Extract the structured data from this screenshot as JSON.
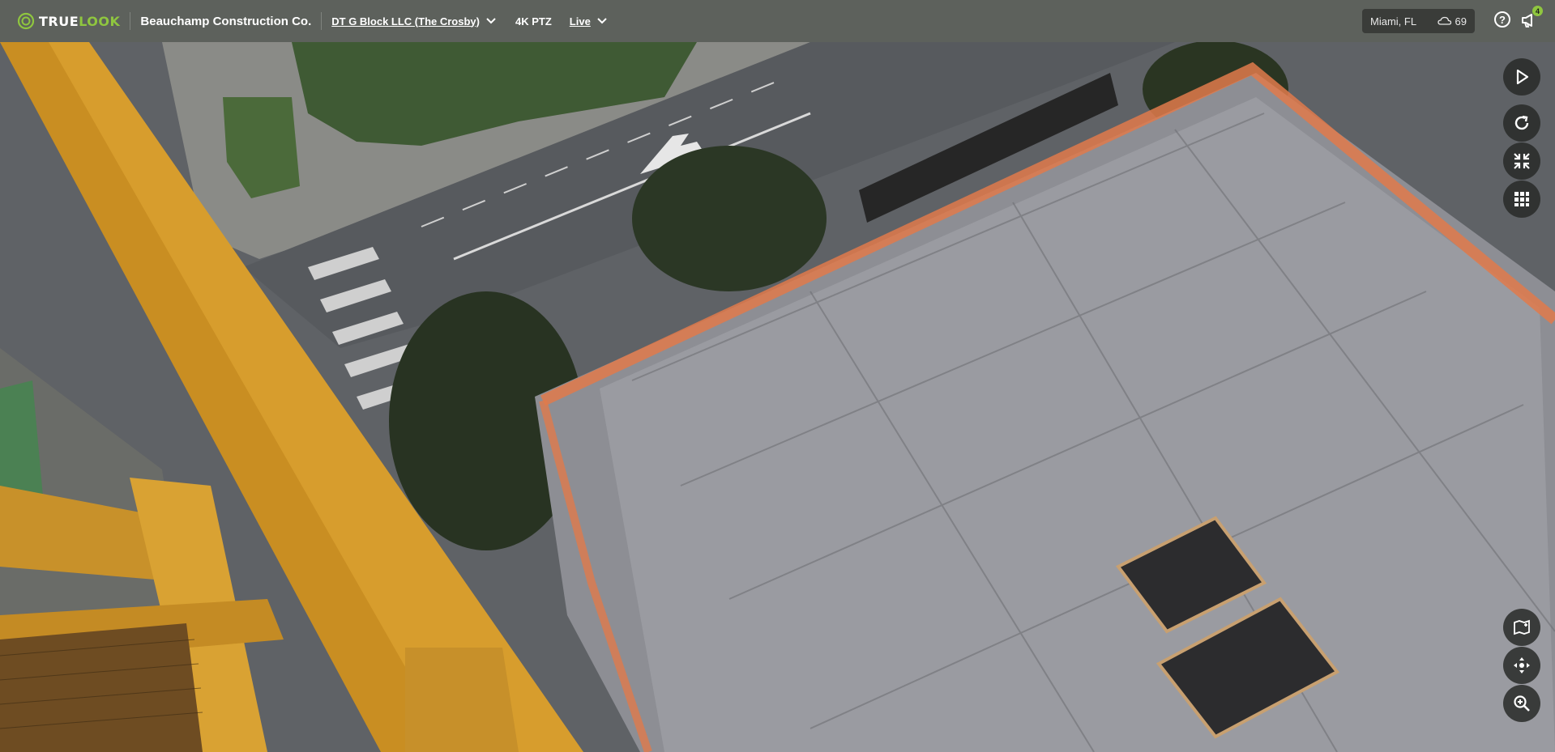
{
  "brand": {
    "logo_true": "TRUE",
    "logo_look": "LOOK",
    "accent": "#8fc63f"
  },
  "header": {
    "company": "Beauchamp Construction Co.",
    "project": "DT G Block LLC (The Crosby)",
    "camera": "4K PTZ",
    "mode": "Live"
  },
  "weather": {
    "location": "Miami, FL",
    "temperature": "69",
    "icon": "partly-cloudy-icon"
  },
  "notifications": {
    "count": "4"
  },
  "controls": {
    "top": [
      "play-icon",
      "refresh-icon",
      "collapse-icon",
      "grid-icon"
    ],
    "bottom": [
      "add-marker-icon",
      "move-icon",
      "zoom-in-icon"
    ]
  },
  "colors": {
    "topbar": "#5d615c",
    "crane": "#d79d2d",
    "fence": "#e07a4b"
  }
}
